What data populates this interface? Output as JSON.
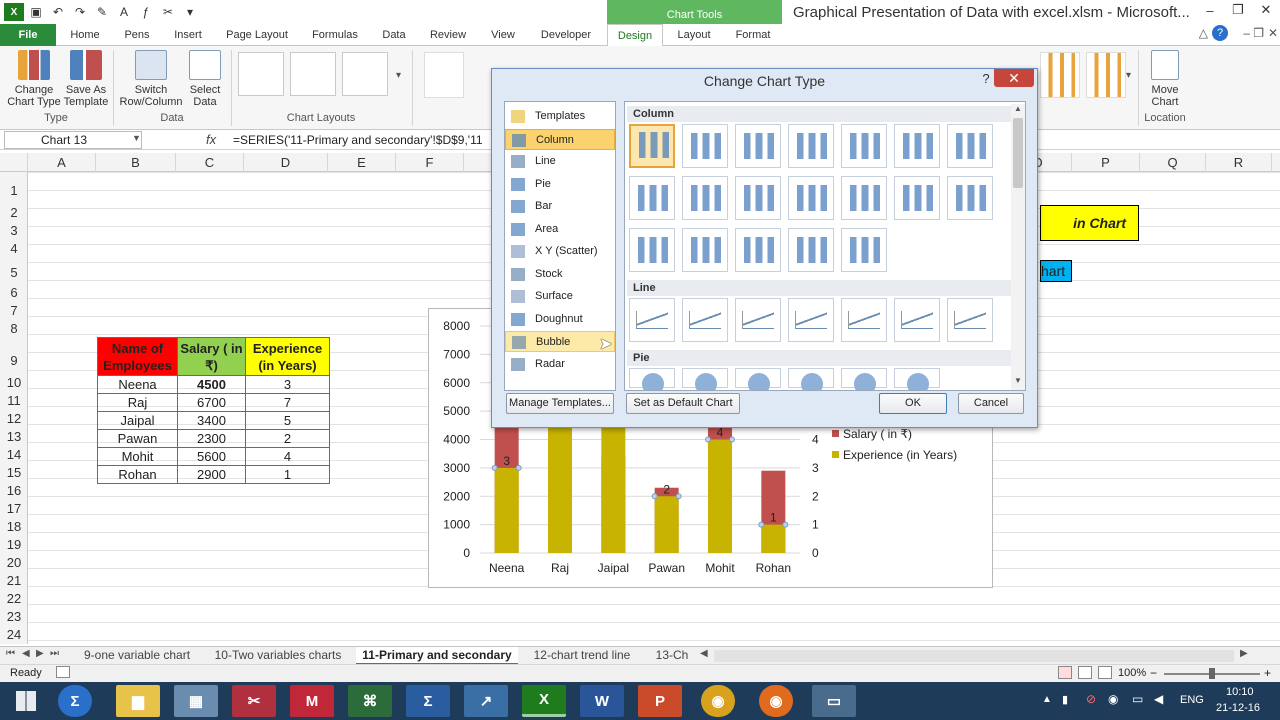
{
  "window": {
    "title": "Graphical Presentation of Data with excel.xlsm - Microsoft...",
    "context_tab_group": "Chart Tools"
  },
  "ribbon_tabs": [
    "File",
    "Home",
    "Pens",
    "Insert",
    "Page Layout",
    "Formulas",
    "Data",
    "Review",
    "View",
    "Developer",
    "Design",
    "Layout",
    "Format"
  ],
  "ribbon": {
    "change_chart_type": "Change\nChart Type",
    "save_as_template": "Save As\nTemplate",
    "group_type": "Type",
    "switch_row_column": "Switch\nRow/Column",
    "select_data": "Select\nData",
    "group_data": "Data",
    "group_chart_layouts": "Chart Layouts",
    "move_chart": "Move\nChart",
    "group_location": "Location"
  },
  "formula_bar": {
    "name_box": "Chart 13",
    "fx": "fx",
    "formula": "=SERIES('11-Primary and secondary'!$D$9,'11"
  },
  "columns": [
    "A",
    "B",
    "C",
    "D",
    "E",
    "F",
    "O",
    "P",
    "Q",
    "R"
  ],
  "rows": [
    "1",
    "2",
    "3",
    "4",
    "5",
    "6",
    "7",
    "8",
    "9",
    "10",
    "11",
    "12",
    "13",
    "14",
    "15",
    "16",
    "17",
    "18",
    "19",
    "20",
    "21",
    "22",
    "23",
    "24"
  ],
  "table": {
    "headers": [
      "Name of Employees",
      "Salary ( in ₹)",
      "Experience (in Years)"
    ],
    "rows": [
      {
        "name": "Neena",
        "salary": "4500",
        "exp": "3"
      },
      {
        "name": "Raj",
        "salary": "6700",
        "exp": "7"
      },
      {
        "name": "Jaipal",
        "salary": "3400",
        "exp": "5"
      },
      {
        "name": "Pawan",
        "salary": "2300",
        "exp": "2"
      },
      {
        "name": "Mohit",
        "salary": "5600",
        "exp": "4"
      },
      {
        "name": "Rohan",
        "salary": "2900",
        "exp": "1"
      }
    ]
  },
  "side_boxes": {
    "yellow_text": "in Chart",
    "blue_text": "hart"
  },
  "chart_data": {
    "type": "bar",
    "categories": [
      "Neena",
      "Raj",
      "Jaipal",
      "Pawan",
      "Mohit",
      "Rohan"
    ],
    "series": [
      {
        "name": "Salary    ( in ₹)",
        "values": [
          4500,
          6700,
          3400,
          2300,
          5600,
          2900
        ],
        "color": "#c0504d",
        "axis": "primary"
      },
      {
        "name": "Experience    (in Years)",
        "values": [
          3,
          7,
          5,
          2,
          4,
          1
        ],
        "color": "#c8b400",
        "axis": "secondary"
      }
    ],
    "y_primary_ticks": [
      "0",
      "1000",
      "2000",
      "3000",
      "4000",
      "5000",
      "6000",
      "7000",
      "8000"
    ],
    "y_secondary_ticks": [
      "0",
      "1",
      "2",
      "3",
      "4"
    ],
    "ylim": [
      0,
      8000
    ],
    "y2lim": [
      0,
      8
    ],
    "data_labels": [
      "3",
      "2",
      "4",
      "1"
    ],
    "legend_position": "right"
  },
  "dialog": {
    "title": "Change Chart Type",
    "help": "?",
    "close": "✕",
    "categories": [
      "Templates",
      "Column",
      "Line",
      "Pie",
      "Bar",
      "Area",
      "X Y (Scatter)",
      "Stock",
      "Surface",
      "Doughnut",
      "Bubble",
      "Radar"
    ],
    "selected_category": "Column",
    "hover_category": "Bubble",
    "sections": [
      "Column",
      "Line",
      "Pie"
    ],
    "manage_templates": "Manage Templates...",
    "set_default": "Set as Default Chart",
    "ok": "OK",
    "cancel": "Cancel"
  },
  "sheet_tabs": [
    "9-one variable chart",
    "10-Two variables charts",
    "11-Primary and secondary",
    "12-chart trend line",
    "13-Ch"
  ],
  "active_sheet": "11-Primary and secondary",
  "status": {
    "ready": "Ready",
    "zoom": "100%"
  },
  "taskbar": {
    "lang": "ENG",
    "time": "10:10",
    "date": "21-12-16"
  },
  "colors": {
    "excel_green": "#217346",
    "dialog_bg": "#dfe8f5",
    "select_orange": "#fbd26d",
    "header_red": "#ff0000",
    "header_green": "#92d050",
    "header_yellow": "#ffff00"
  }
}
